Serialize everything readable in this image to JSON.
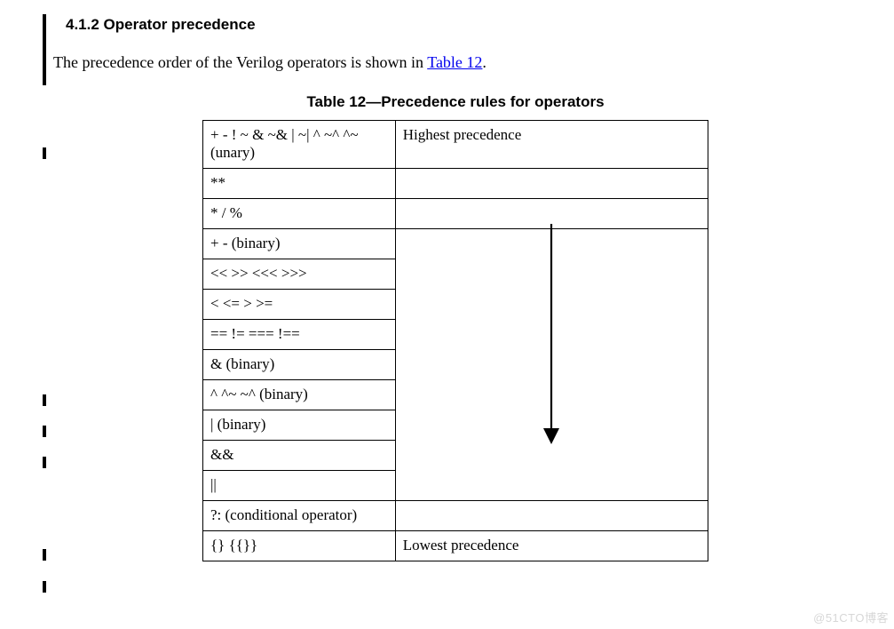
{
  "heading": "4.1.2 Operator precedence",
  "intro_pre": "The precedence order of the Verilog operators is shown in ",
  "intro_link": "Table 12",
  "intro_post": ".",
  "table_caption": "Table 12—Precedence rules for operators",
  "top_label": "Highest precedence",
  "bottom_label": "Lowest precedence",
  "rows": [
    "+ - ! ~ & ~& | ~| ^ ~^ ^~ (unary)",
    "**",
    "*  /  %",
    "+  - (binary)",
    "<<  >>  <<<  >>>",
    "<  <=  >  >=",
    "==  !=  ===  !==",
    "& (binary)",
    "^  ^~  ~^ (binary)",
    "| (binary)",
    "&&",
    "||",
    "?: (conditional operator)",
    "{}  {{}}"
  ],
  "watermark": "@51CTO博客"
}
